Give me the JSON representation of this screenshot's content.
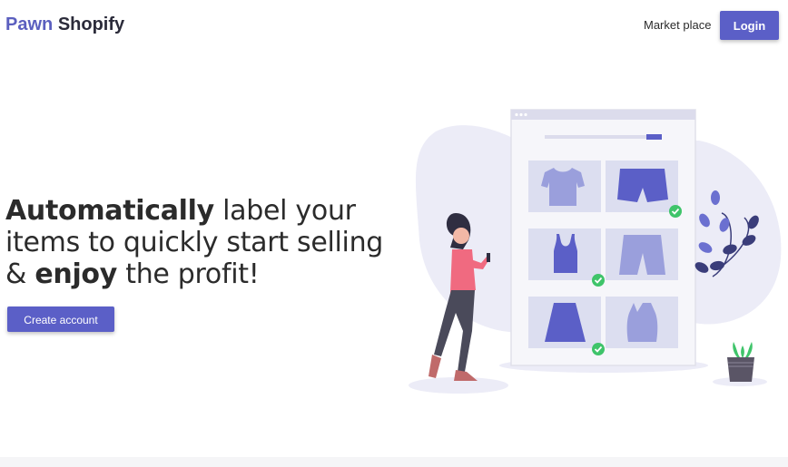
{
  "header": {
    "brand_first": "Pawn",
    "brand_second": "Shopify",
    "nav_link": "Market place",
    "login_label": "Login"
  },
  "hero": {
    "headline_part1": "Automatically",
    "headline_part2": " label your items to quickly start selling & ",
    "headline_part3": "enjoy",
    "headline_part4": " the profit!",
    "cta_label": "Create account"
  },
  "colors": {
    "accent": "#5b5fc7",
    "illustration_purple": "#6b70d0",
    "dark_navy": "#3a3d7a",
    "check_green": "#3fc46a",
    "shirt_pink": "#f06a80"
  },
  "illustration": {
    "name": "store-catalog-illustration",
    "items": [
      "t-shirt-icon",
      "shorts-icon",
      "tank-top-icon",
      "shorts-icon",
      "skirt-icon",
      "vest-icon"
    ],
    "checked": [
      false,
      true,
      false,
      true,
      true,
      false
    ]
  }
}
